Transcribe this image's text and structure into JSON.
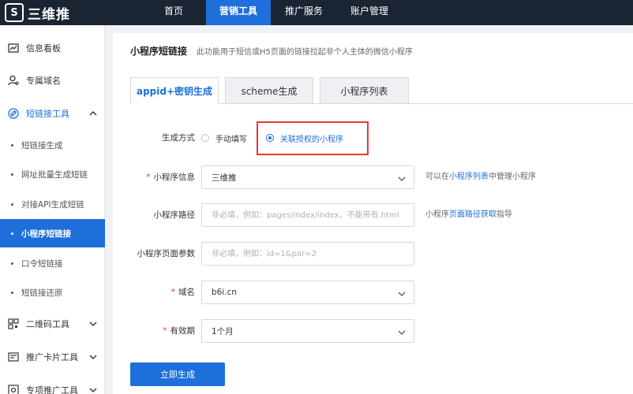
{
  "app": {
    "logo_text": "三维推"
  },
  "topnav": {
    "items": [
      {
        "label": "首页"
      },
      {
        "label": "营销工具"
      },
      {
        "label": "推广服务"
      },
      {
        "label": "账户管理"
      }
    ]
  },
  "sidebar": {
    "groups": [
      {
        "label": "信息看板",
        "icon": "dashboard-icon"
      },
      {
        "label": "专属域名",
        "icon": "user-domain-icon"
      },
      {
        "label": "短链接工具",
        "icon": "link-icon"
      },
      {
        "label": "二维码工具",
        "icon": "qrcode-icon"
      },
      {
        "label": "推广卡片工具",
        "icon": "card-icon"
      },
      {
        "label": "专项推广工具",
        "icon": "promo-icon"
      }
    ],
    "subitems": [
      {
        "label": "短链接生成"
      },
      {
        "label": "网址批量生成短链"
      },
      {
        "label": "对接API生成短链"
      },
      {
        "label": "小程序短链接"
      },
      {
        "label": "口令短链接"
      },
      {
        "label": "短链接还原"
      }
    ]
  },
  "page": {
    "title": "小程序短链接",
    "description": "此功能用于短信或H5页面的链接拉起非个人主体的微信小程序"
  },
  "tabs": [
    {
      "label": "appid+密钥生成"
    },
    {
      "label": "scheme生成"
    },
    {
      "label": "小程序列表"
    }
  ],
  "form": {
    "mode": {
      "label": "生成方式",
      "option_manual": "手动填写",
      "option_linked": "关联授权的小程序"
    },
    "miniapp_info": {
      "required_mark": "*",
      "label": "小程序信息",
      "value": "三维推",
      "hint_prefix": "可以在",
      "hint_link": "小程序列表",
      "hint_suffix": "中管理小程序"
    },
    "path": {
      "label": "小程序路径",
      "placeholder": "非必填，例如：pages/index/index，不能带有.html",
      "hint_prefix": "小程序",
      "hint_link": "页面路径获取",
      "hint_suffix": "指导"
    },
    "params": {
      "label": "小程序页面参数",
      "placeholder": "非必填，例如：id=1&par=2"
    },
    "domain": {
      "required_mark": "*",
      "label": "域名",
      "value": "b6i.cn"
    },
    "validity": {
      "required_mark": "*",
      "label": "有效期",
      "value": "1个月"
    },
    "submit_label": "立即生成"
  },
  "colors": {
    "accent": "#1e6fd9",
    "topbar": "#1b2433",
    "highlight_border": "#e53935"
  }
}
